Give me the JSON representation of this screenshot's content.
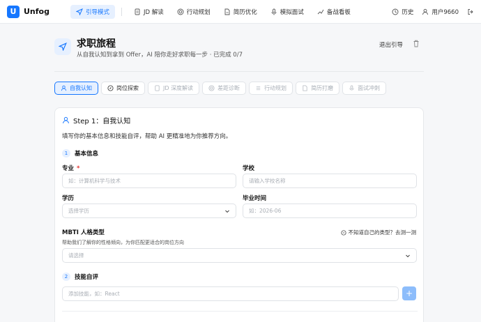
{
  "app": {
    "name": "Unfog",
    "logo_letter": "U"
  },
  "nav": {
    "items": [
      {
        "label": "引导模式",
        "icon": "navigation-icon",
        "active": true
      },
      {
        "label": "JD 解读",
        "icon": "document-icon",
        "active": false
      },
      {
        "label": "行动规划",
        "icon": "target-icon",
        "active": false
      },
      {
        "label": "简历优化",
        "icon": "file-icon",
        "active": false
      },
      {
        "label": "模拟面试",
        "icon": "microphone-icon",
        "active": false
      },
      {
        "label": "备战看板",
        "icon": "trend-icon",
        "active": false
      }
    ],
    "history_label": "历史",
    "user_label": "用户9660"
  },
  "header": {
    "title": "求职旅程",
    "subtitle": "从自我认知到拿到 Offer，AI 陪你走好求职每一步 · 已完成 0/7",
    "exit_label": "退出引导"
  },
  "steps": [
    {
      "label": "自我认知",
      "state": "active"
    },
    {
      "label": "岗位探索",
      "state": "done"
    },
    {
      "label": "JD 深度解读",
      "state": "disabled"
    },
    {
      "label": "差距诊断",
      "state": "disabled"
    },
    {
      "label": "行动规划",
      "state": "disabled"
    },
    {
      "label": "简历打磨",
      "state": "disabled"
    },
    {
      "label": "面试冲刺",
      "state": "disabled"
    }
  ],
  "card": {
    "title": "Step 1：自我认知",
    "description": "填写你的基本信息和技能自评，帮助 AI 更精准地为你推荐方向。",
    "section1": {
      "num": "1",
      "label": "基本信息"
    },
    "major": {
      "label": "专业",
      "required": "*",
      "placeholder": "如：计算机科学与技术"
    },
    "school": {
      "label": "学校",
      "placeholder": "请输入学校名称"
    },
    "degree": {
      "label": "学历",
      "placeholder": "选择学历"
    },
    "grad": {
      "label": "毕业时间",
      "placeholder": "如：2026-06"
    },
    "mbti": {
      "label": "MBTI 人格类型",
      "help": "不知道自己的类型？去测一测",
      "sub": "帮助我们了解你的性格倾向，为你匹配更适合的岗位方向",
      "placeholder": "请选择"
    },
    "section2": {
      "num": "2",
      "label": "技能自评"
    },
    "skill": {
      "placeholder": "添加技能，如：React",
      "add": "+"
    }
  },
  "colors": {
    "accent": "#1677ff",
    "accent_bg": "#e6f0ff"
  }
}
